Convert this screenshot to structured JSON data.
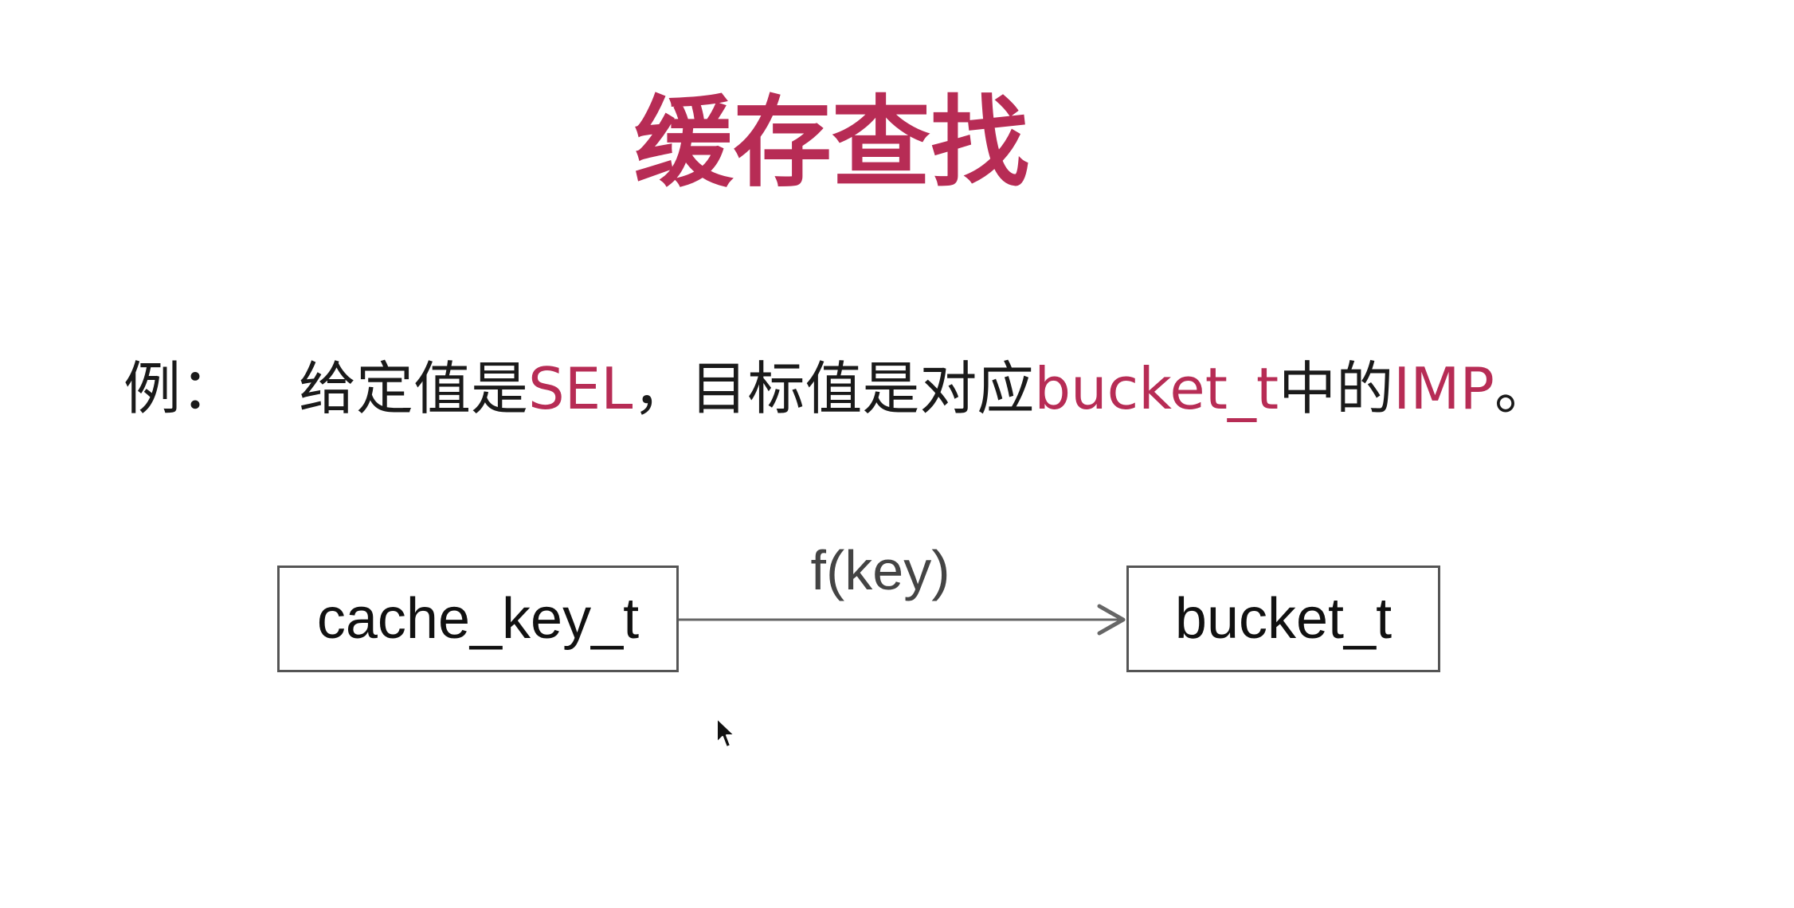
{
  "slide": {
    "title": "缓存查找",
    "example": {
      "prefix": "例：",
      "text_1": "给定值是",
      "highlight_1": "SEL",
      "text_2": "，目标值是对应",
      "highlight_2": "bucket_t",
      "text_3": "中的",
      "highlight_3": "IMP",
      "text_4": "。"
    }
  },
  "diagram": {
    "source_box": "cache_key_t",
    "target_box": "bucket_t",
    "arrow_label": "f(key)"
  },
  "colors": {
    "accent": "#b72c55",
    "text": "#1a1a1a",
    "box_border": "#555555",
    "arrow": "#666666"
  },
  "icons": {
    "cursor": "mouse-pointer-icon"
  }
}
